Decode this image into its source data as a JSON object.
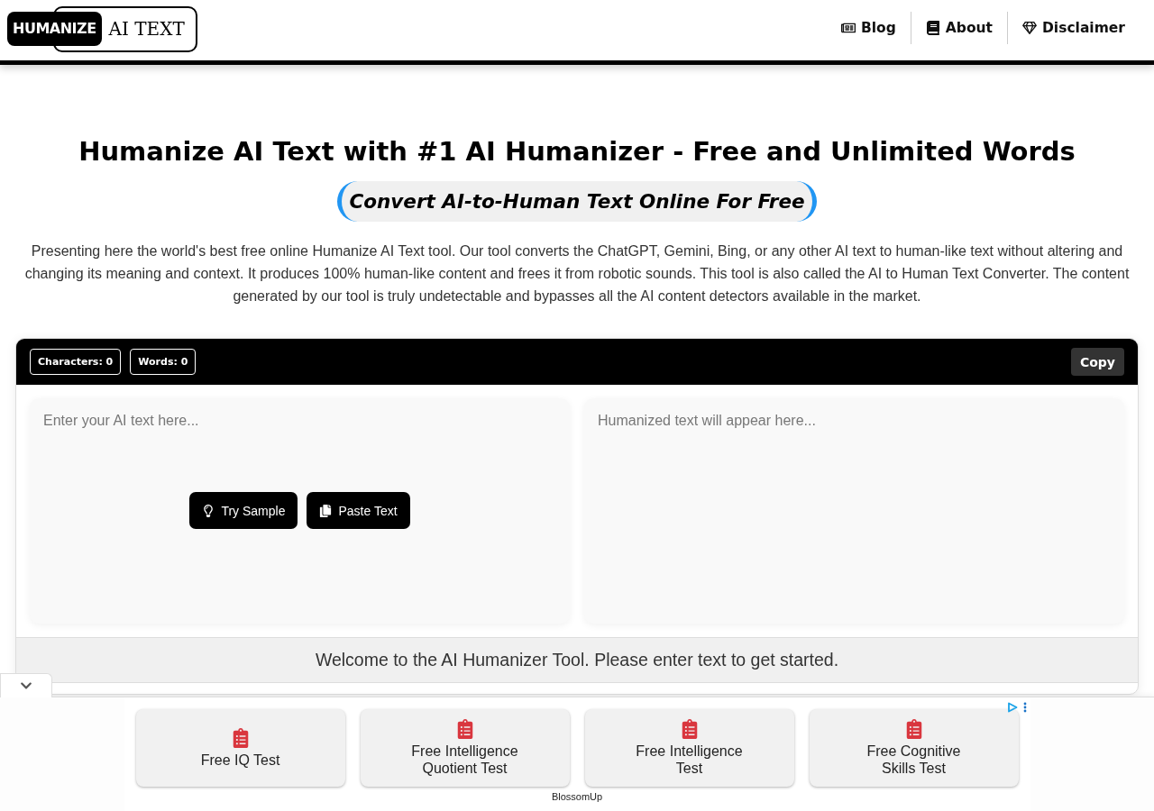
{
  "header": {
    "logo": {
      "badge": "HUMANIZE",
      "text": "AI TEXT"
    },
    "nav": [
      {
        "label": "Blog"
      },
      {
        "label": "About"
      },
      {
        "label": "Disclaimer"
      }
    ]
  },
  "hero": {
    "title": "Humanize AI Text with #1 AI Humanizer - Free and Unlimited Words",
    "subtitle": "Convert AI-to-Human Text Online For Free",
    "intro": "Presenting here the world's best free online Humanize AI Text tool. Our tool converts the ChatGPT, Gemini, Bing, or any other AI text to human-like text without altering and changing its meaning and context. It produces 100% human-like content and frees it from robotic sounds. This tool is also called the AI to Human Text Converter. The content generated by our tool is truly undetectable and bypasses all the AI content detectors available in the market."
  },
  "tool": {
    "counters": [
      "Characters: 0",
      "Words: 0"
    ],
    "copy_button": "Copy",
    "input": {
      "placeholder": "Enter your AI text here..."
    },
    "actions": [
      "Try Sample",
      "Paste Text"
    ],
    "output": {
      "placeholder": "Humanized text will appear here..."
    },
    "status": "Welcome to the AI Humanizer Tool. Please enter text to get started."
  },
  "ad": {
    "items": [
      "Free IQ Test",
      "Free Intelligence Quotient Test",
      "Free Intelligence Test",
      "Free Cognitive Skills Test"
    ],
    "sponsor": "BlossomUp"
  }
}
